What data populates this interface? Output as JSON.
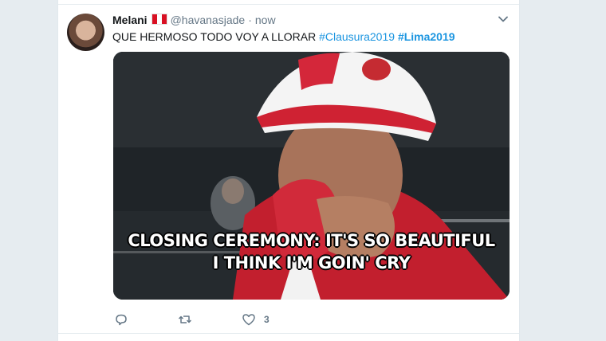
{
  "tweet": {
    "name": "Melani",
    "flag": "Peru flag",
    "handle": "@havanasjade",
    "separator": "·",
    "time": "now",
    "text_plain": "QUE HERMOSO TODO VOY A LLORAR ",
    "hashtag_1": "#Clausura2019",
    "hashtag_2": "#Lima2019"
  },
  "media": {
    "caption_line_1": "CLOSING CEREMONY: IT'S SO BEAUTIFUL",
    "caption_line_2": "I THINK I'M GOIN' CRY"
  },
  "actions": {
    "reply_icon": "reply-icon",
    "retweet_icon": "retweet-icon",
    "like_icon": "heart-icon",
    "like_count": "3"
  },
  "colors": {
    "background": "#e6ecf0",
    "link": "#1b95e0",
    "text": "#14171a",
    "muted": "#657786"
  }
}
